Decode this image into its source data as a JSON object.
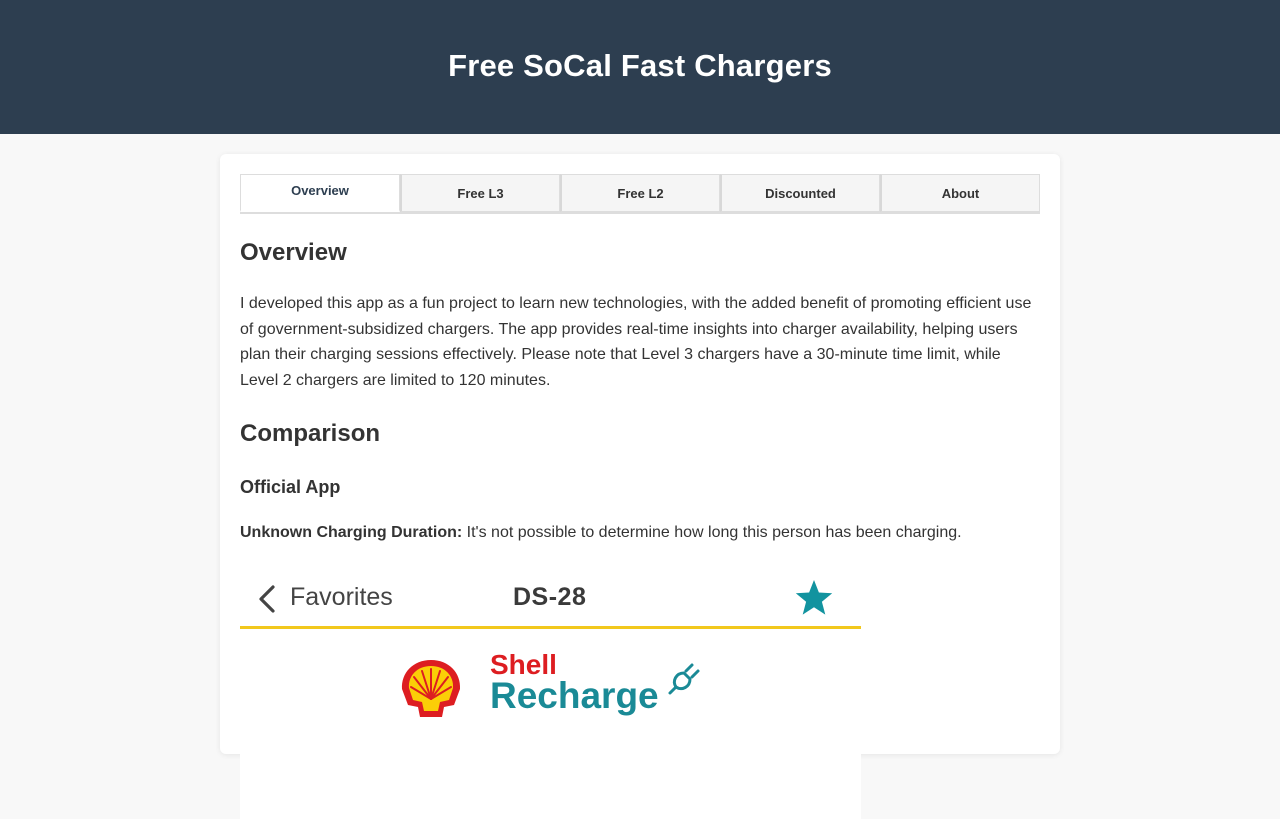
{
  "header": {
    "title": "Free SoCal Fast Chargers",
    "background": "#2d3e50"
  },
  "tabs": [
    {
      "label": "Overview",
      "active": true
    },
    {
      "label": "Free L3",
      "active": false
    },
    {
      "label": "Free L2",
      "active": false
    },
    {
      "label": "Discounted",
      "active": false
    },
    {
      "label": "About",
      "active": false
    }
  ],
  "overview": {
    "title": "Overview",
    "text": "I developed this app as a fun project to learn new technologies, with the added benefit of promoting efficient use of government-subsidized chargers. The app provides real-time insights into charger availability, helping users plan their charging sessions effectively. Please note that Level 3 chargers have a 30-minute time limit, while Level 2 chargers are limited to 120 minutes."
  },
  "comparison": {
    "title": "Comparison",
    "official_app_title": "Official App",
    "duration_label": "Unknown Charging Duration:",
    "duration_text": " It's not possible to determine how long this person has been charging."
  },
  "screenshot": {
    "back_icon": "chevron-left-icon",
    "back_label": "Favorites",
    "station_id": "DS-28",
    "star_icon": "star-icon",
    "star_color": "#12939f",
    "accent_line_color": "#f2c81c",
    "brand_line1": "Shell",
    "brand_line2": "Recharge",
    "brand_red": "#dd1d21",
    "brand_teal": "#1a8a96"
  }
}
